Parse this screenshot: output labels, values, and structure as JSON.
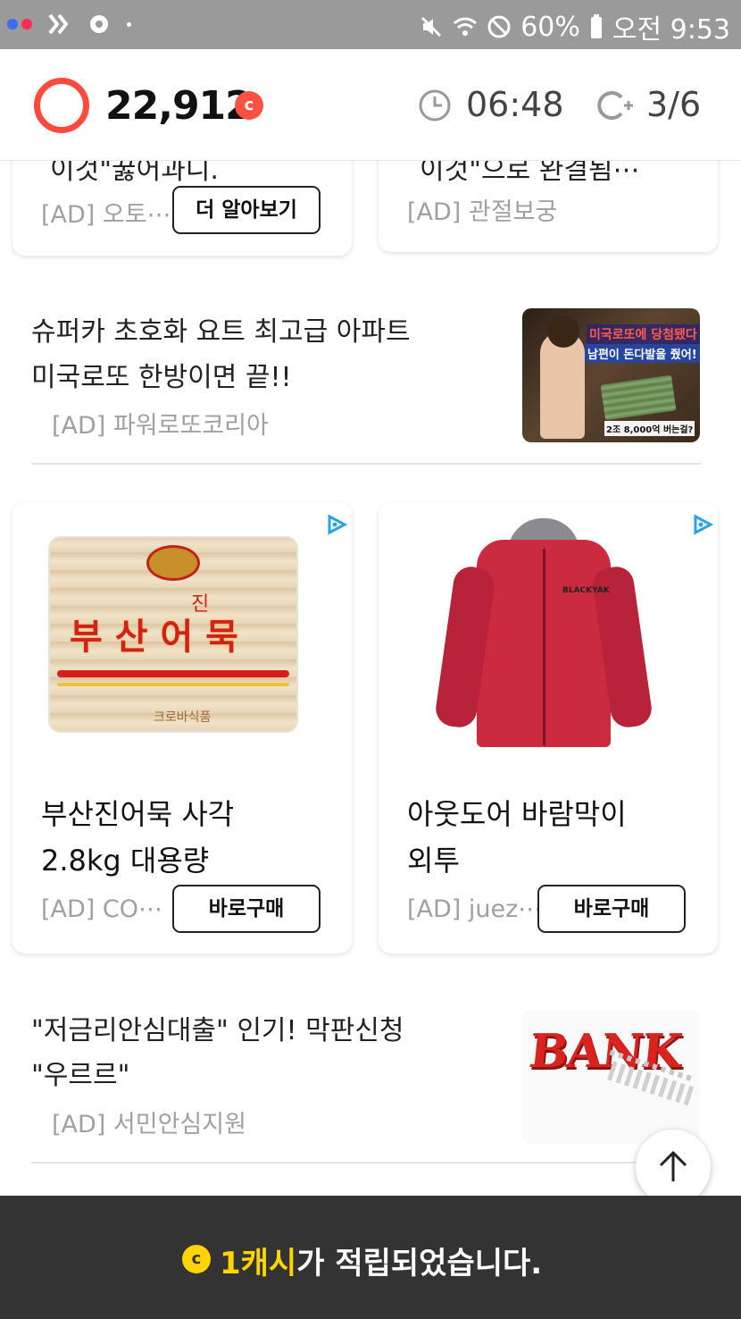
{
  "statusbar": {
    "battery": "60%",
    "time": "오전 9:53"
  },
  "header": {
    "points": "22,912",
    "coin_symbol": "c",
    "timer": "06:48",
    "progress": "3/6"
  },
  "top_cards": [
    {
      "clipped_title": "이것\"꿇어과니.",
      "source": "[AD] 오토⋯",
      "button": "더 알아보기"
    },
    {
      "clipped_title": "이것\"으로 완결됨⋯",
      "source": "[AD] 관절보궁"
    }
  ],
  "ad_rows": [
    {
      "title_line1": "슈퍼카 초호화 요트 최고급 아파트",
      "title_line2": "미국로또 한방이면 끝!!",
      "source": "[AD] 파워로또코리아"
    },
    {
      "title_line1": "\"저금리안심대출\" 인기! 막판신청",
      "title_line2": "\"우르르\"",
      "source": "[AD] 서민안심지원"
    }
  ],
  "products": [
    {
      "title_line1": "부산진어묵 사각",
      "title_line2": "2.8kg 대용량",
      "source": "[AD] CO⋯",
      "button": "바로구매",
      "image_text_main": "부 산 어 묵",
      "image_text_sub": "진",
      "image_text_small": "크로바식품"
    },
    {
      "title_line1": "아웃도어 바람막이",
      "title_line2": "외투",
      "source": "[AD] juez⋯",
      "button": "바로구매",
      "image_text_logo": "BLACKYAK"
    }
  ],
  "lotto_image_text": {
    "line1": "미국로또에 당첨됐다",
    "line2": "남편이 돈다발을 줬어!",
    "line3": "2조 8,000억 버는걸?"
  },
  "bank_image_text": "BANK",
  "toast": {
    "highlight": "1캐시",
    "rest": "가 적립되었습니다.",
    "coin_symbol": "c"
  },
  "colors": {
    "accent_red": "#ff4a3d",
    "toast_bg": "#333333",
    "toast_highlight": "#ffd400"
  }
}
